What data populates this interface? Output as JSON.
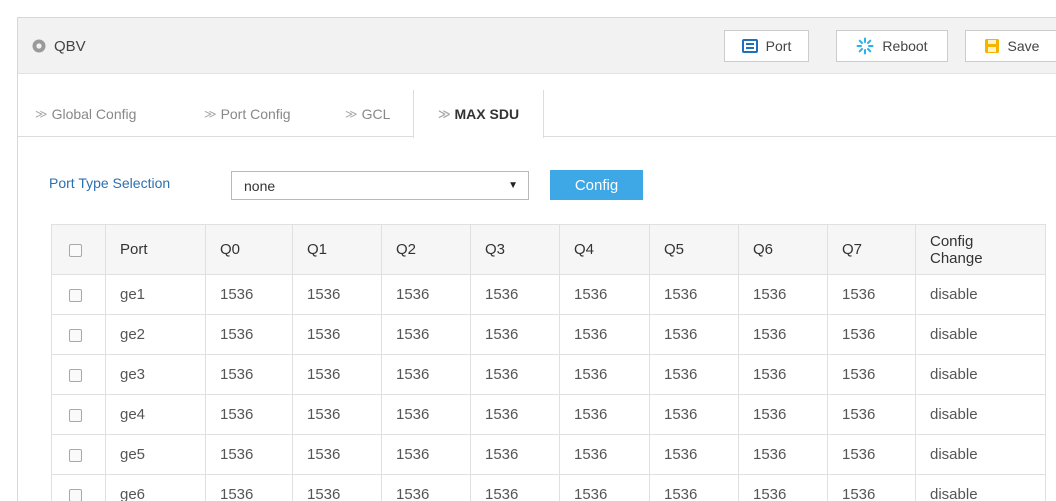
{
  "header": {
    "title": "QBV",
    "buttons": {
      "port": "Port",
      "reboot": "Reboot",
      "save": "Save"
    }
  },
  "tabs": [
    "Global Config",
    "Port Config",
    "GCL",
    "MAX SDU"
  ],
  "active_tab": "MAX SDU",
  "selection": {
    "label": "Port Type Selection",
    "value": "none",
    "config_button": "Config"
  },
  "table": {
    "columns": [
      "Port",
      "Q0",
      "Q1",
      "Q2",
      "Q3",
      "Q4",
      "Q5",
      "Q6",
      "Q7"
    ],
    "config_change_header": [
      "Config",
      "Change"
    ],
    "rows": [
      {
        "port": "ge1",
        "q": [
          "1536",
          "1536",
          "1536",
          "1536",
          "1536",
          "1536",
          "1536",
          "1536"
        ],
        "config_change": "disable"
      },
      {
        "port": "ge2",
        "q": [
          "1536",
          "1536",
          "1536",
          "1536",
          "1536",
          "1536",
          "1536",
          "1536"
        ],
        "config_change": "disable"
      },
      {
        "port": "ge3",
        "q": [
          "1536",
          "1536",
          "1536",
          "1536",
          "1536",
          "1536",
          "1536",
          "1536"
        ],
        "config_change": "disable"
      },
      {
        "port": "ge4",
        "q": [
          "1536",
          "1536",
          "1536",
          "1536",
          "1536",
          "1536",
          "1536",
          "1536"
        ],
        "config_change": "disable"
      },
      {
        "port": "ge5",
        "q": [
          "1536",
          "1536",
          "1536",
          "1536",
          "1536",
          "1536",
          "1536",
          "1536"
        ],
        "config_change": "disable"
      },
      {
        "port": "ge6",
        "q": [
          "1536",
          "1536",
          "1536",
          "1536",
          "1536",
          "1536",
          "1536",
          "1536"
        ],
        "config_change": "disable"
      }
    ]
  },
  "colors": {
    "accent": "#3ea7e6",
    "label_blue": "#2c6fb0",
    "port_icon": "#1f6fbf",
    "reboot_icon": "#2bb0e8",
    "save_icon": "#f5b400"
  },
  "icons": {
    "title": "gear-icon",
    "port": "port-icon",
    "reboot": "reboot-icon",
    "save": "save-icon",
    "tab": "chevron-right-icon"
  }
}
